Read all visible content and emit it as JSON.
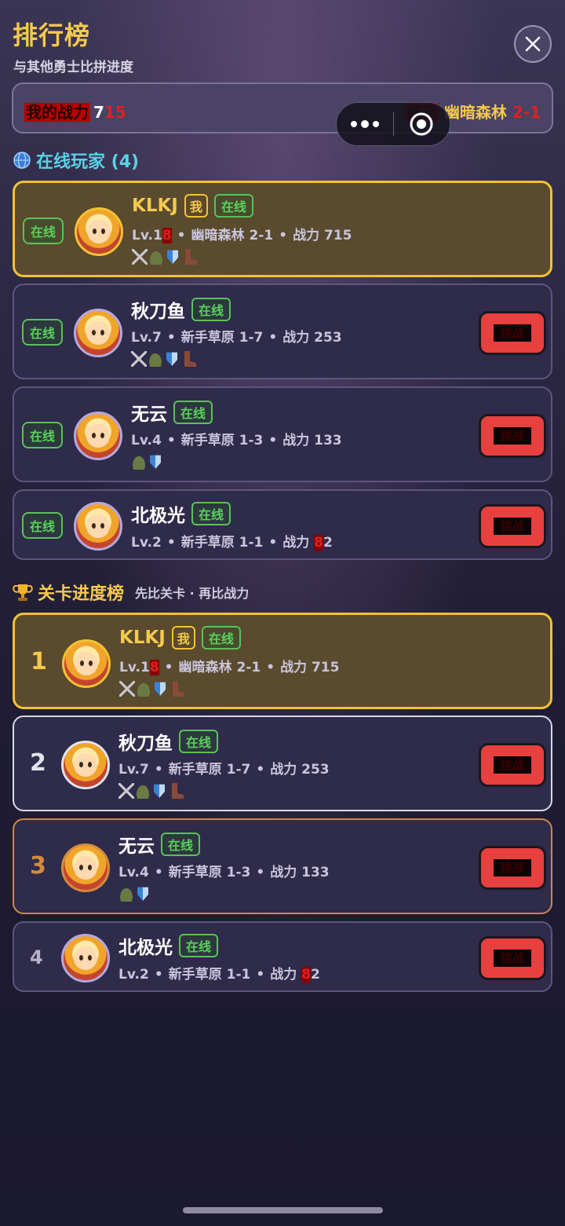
{
  "header": {
    "title": "排行榜",
    "subtitle": "与其他勇士比拼进度"
  },
  "stats": {
    "power_label": "我的战力",
    "power_value_lead": "7",
    "power_value_tail": "15",
    "best_label": "最高",
    "best_stage_name": "幽暗森林",
    "best_stage_num": "2-1"
  },
  "online_section": {
    "title": "在线玩家 (4)"
  },
  "ranking_section": {
    "title": "关卡进度榜",
    "subtitle": "先比关卡 · 再比战力"
  },
  "labels": {
    "online": "在线",
    "me": "我",
    "battle": "挑战"
  },
  "online_players": [
    {
      "name": "KLKJ",
      "is_me": true,
      "level_pre": "Lv.1",
      "level_red": "8",
      "stage": "幽暗森林 2-1",
      "power_pre": "战力 715",
      "power_red": "",
      "power_post": "",
      "equipment": [
        "sword-icon",
        "helmet-icon",
        "shield-icon",
        "boot-icon"
      ]
    },
    {
      "name": "秋刀鱼",
      "is_me": false,
      "level_pre": "Lv.7",
      "level_red": "",
      "stage": "新手草原 1-7",
      "power_pre": "战力 253",
      "power_red": "",
      "power_post": "",
      "equipment": [
        "sword-icon",
        "helmet-icon",
        "shield-icon",
        "boot-icon"
      ]
    },
    {
      "name": "无云",
      "is_me": false,
      "level_pre": "Lv.4",
      "level_red": "",
      "stage": "新手草原 1-3",
      "power_pre": "战力 133",
      "power_red": "",
      "power_post": "",
      "equipment": [
        "helmet-icon",
        "shield-icon"
      ]
    },
    {
      "name": "北极光",
      "is_me": false,
      "level_pre": "Lv.2",
      "level_red": "",
      "stage": "新手草原 1-1",
      "power_pre": "战力 ",
      "power_red": "8",
      "power_post": "2",
      "equipment": []
    }
  ],
  "ranking": [
    {
      "rank": "1",
      "name": "KLKJ",
      "is_me": true,
      "level_pre": "Lv.1",
      "level_red": "8",
      "stage": "幽暗森林 2-1",
      "power_pre": "战力 715",
      "power_red": "",
      "power_post": "",
      "equipment": [
        "sword-icon",
        "helmet-icon",
        "shield-icon",
        "boot-icon"
      ]
    },
    {
      "rank": "2",
      "name": "秋刀鱼",
      "is_me": false,
      "level_pre": "Lv.7",
      "level_red": "",
      "stage": "新手草原 1-7",
      "power_pre": "战力 253",
      "power_red": "",
      "power_post": "",
      "equipment": [
        "sword-icon",
        "helmet-icon",
        "shield-icon",
        "boot-icon"
      ]
    },
    {
      "rank": "3",
      "name": "无云",
      "is_me": false,
      "level_pre": "Lv.4",
      "level_red": "",
      "stage": "新手草原 1-3",
      "power_pre": "战力 133",
      "power_red": "",
      "power_post": "",
      "equipment": [
        "helmet-icon",
        "shield-icon"
      ]
    },
    {
      "rank": "4",
      "name": "北极光",
      "is_me": false,
      "level_pre": "Lv.2",
      "level_red": "",
      "stage": "新手草原 1-1",
      "power_pre": "战力 ",
      "power_red": "8",
      "power_post": "2",
      "equipment": []
    }
  ],
  "colors": {
    "gold": "#f5c94c",
    "online_green": "#59d15a",
    "battle_red": "#e8403e",
    "card_bg": "#2f2b4a"
  }
}
